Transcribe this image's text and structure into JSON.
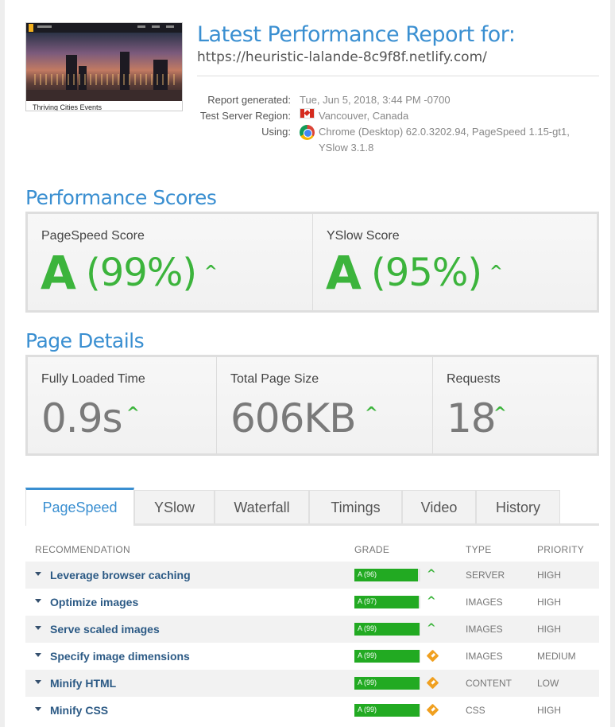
{
  "header": {
    "thumbnail_caption": "Thriving Cities Events",
    "title": "Latest Performance Report for:",
    "url": "https://heuristic-lalande-8c9f8f.netlify.com/",
    "meta": {
      "generated_label": "Report generated:",
      "generated_value": "Tue, Jun 5, 2018, 3:44 PM -0700",
      "region_label": "Test Server Region:",
      "region_value": "Vancouver, Canada",
      "using_label": "Using:",
      "using_value_line1": "Chrome (Desktop) 62.0.3202.94, PageSpeed 1.15-gt1,",
      "using_value_line2": "YSlow 3.1.8"
    }
  },
  "scores": {
    "heading": "Performance Scores",
    "pagespeed": {
      "label": "PageSpeed Score",
      "grade": "A",
      "percent": "(99%)"
    },
    "yslow": {
      "label": "YSlow Score",
      "grade": "A",
      "percent": "(95%)"
    }
  },
  "details": {
    "heading": "Page Details",
    "load_time": {
      "label": "Fully Loaded Time",
      "value": "0.9s"
    },
    "page_size": {
      "label": "Total Page Size",
      "value": "606KB"
    },
    "requests": {
      "label": "Requests",
      "value": "18"
    }
  },
  "tabs": [
    {
      "label": "PageSpeed"
    },
    {
      "label": "YSlow"
    },
    {
      "label": "Waterfall"
    },
    {
      "label": "Timings"
    },
    {
      "label": "Video"
    },
    {
      "label": "History"
    }
  ],
  "table": {
    "headers": {
      "recommendation": "RECOMMENDATION",
      "grade": "GRADE",
      "type": "TYPE",
      "priority": "PRIORITY"
    },
    "rows": [
      {
        "name": "Leverage browser caching",
        "grade": "A (96)",
        "score": 96,
        "indicator": "up",
        "type": "SERVER",
        "priority": "HIGH"
      },
      {
        "name": "Optimize images",
        "grade": "A (97)",
        "score": 97,
        "indicator": "up",
        "type": "IMAGES",
        "priority": "HIGH"
      },
      {
        "name": "Serve scaled images",
        "grade": "A (99)",
        "score": 99,
        "indicator": "up",
        "type": "IMAGES",
        "priority": "HIGH"
      },
      {
        "name": "Specify image dimensions",
        "grade": "A (99)",
        "score": 99,
        "indicator": "diamond",
        "type": "IMAGES",
        "priority": "MEDIUM"
      },
      {
        "name": "Minify HTML",
        "grade": "A (99)",
        "score": 99,
        "indicator": "diamond",
        "type": "CONTENT",
        "priority": "LOW"
      },
      {
        "name": "Minify CSS",
        "grade": "A (99)",
        "score": 99,
        "indicator": "diamond",
        "type": "CSS",
        "priority": "HIGH"
      }
    ]
  },
  "colors": {
    "accent": "#3a8fd1",
    "good": "#3cb43c",
    "bar": "#22aa22",
    "warn": "#f0a020"
  }
}
